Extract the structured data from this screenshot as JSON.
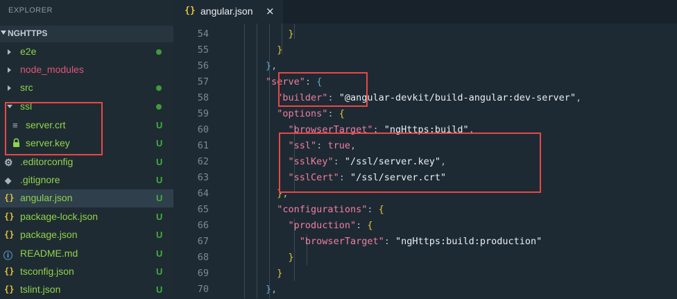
{
  "explorer": {
    "title": "EXPLORER",
    "project": "NGHTTPS",
    "items": [
      {
        "label": "e2e",
        "type": "folder",
        "status": "dot"
      },
      {
        "label": "node_modules",
        "type": "folder",
        "status": ""
      },
      {
        "label": "src",
        "type": "folder",
        "status": "dot"
      },
      {
        "label": "ssl",
        "type": "folder-open",
        "status": "dot"
      },
      {
        "label": "server.crt",
        "type": "file",
        "status": "U"
      },
      {
        "label": "server.key",
        "type": "file",
        "status": "U"
      },
      {
        "label": ".editorconfig",
        "type": "file",
        "status": "U"
      },
      {
        "label": ".gitignore",
        "type": "file",
        "status": "U"
      },
      {
        "label": "angular.json",
        "type": "file",
        "status": "U"
      },
      {
        "label": "package-lock.json",
        "type": "file",
        "status": "U"
      },
      {
        "label": "package.json",
        "type": "file",
        "status": "U"
      },
      {
        "label": "README.md",
        "type": "file",
        "status": "U"
      },
      {
        "label": "tsconfig.json",
        "type": "file",
        "status": "U"
      },
      {
        "label": "tslint.json",
        "type": "file",
        "status": "U"
      }
    ]
  },
  "tab": {
    "icon_text": "{}",
    "label": "angular.json",
    "close": "×"
  },
  "colors": {
    "accent": "#e2c23c",
    "highlight": "#e84848",
    "untracked": "#3fae3f"
  },
  "code": {
    "line_numbers": [
      "54",
      "55",
      "56",
      "57",
      "58",
      "59",
      "60",
      "61",
      "62",
      "63",
      "64",
      "65",
      "66",
      "67",
      "68",
      "69",
      "70"
    ],
    "serve_key": "\"serve\"",
    "builder_key": "\"builder\"",
    "builder_val": "\"@angular-devkit/build-angular:dev-server\"",
    "options_key": "\"options\"",
    "browserTarget_key": "\"browserTarget\"",
    "browserTarget_val": "\"ngHttps:build\"",
    "ssl_key": "\"ssl\"",
    "ssl_val": "true",
    "sslKey_key": "\"sslKey\"",
    "sslKey_val": "\"/ssl/server.key\"",
    "sslCert_key": "\"sslCert\"",
    "sslCert_val": "\"/ssl/server.crt\"",
    "configurations_key": "\"configurations\"",
    "production_key": "\"production\"",
    "prod_browserTarget_key": "\"browserTarget\"",
    "prod_browserTarget_val": "\"ngHttps:build:production\""
  }
}
